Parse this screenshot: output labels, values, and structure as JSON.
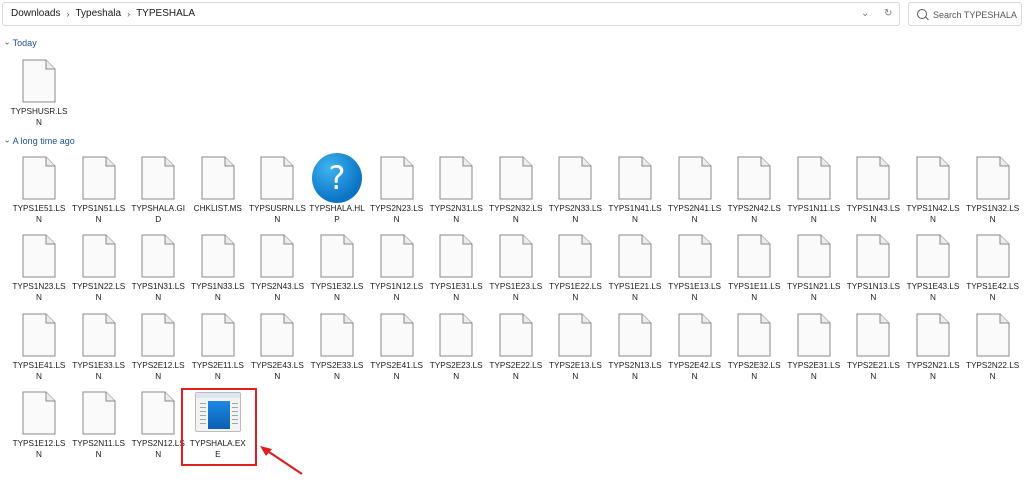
{
  "address_bar": {
    "crumbs": [
      "Downloads",
      "Typeshala",
      "TYPESHALA"
    ]
  },
  "search": {
    "placeholder": "Search TYPESHALA"
  },
  "groups": {
    "today": "Today",
    "long_ago": "A long time ago"
  },
  "files": {
    "today": [
      "TYPSHUSR.LSN"
    ],
    "row1": [
      "TYPS1E51.LSN",
      "TYPS1N51.LSN",
      "TYPSHALA.GID",
      "CHKLIST.MS",
      "TYPSUSRN.LSN",
      "TYPSHALA.HLP",
      "TYPS2N23.LSN",
      "TYPS2N31.LSN",
      "TYPS2N32.LSN",
      "TYPS2N33.LSN",
      "TYPS1N41.LSN",
      "TYPS2N41.LSN",
      "TYPS2N42.LSN",
      "TYPS1N11.LSN",
      "TYPS1N43.LSN",
      "TYPS1N42.LSN",
      "TYPS1N32.LSN"
    ],
    "row2": [
      "TYPS1N23.LSN",
      "TYPS1N22.LSN",
      "TYPS1N31.LSN",
      "TYPS1N33.LSN",
      "TYPS2N43.LSN",
      "TYPS1E32.LSN",
      "TYPS1N12.LSN",
      "TYPS1E31.LSN",
      "TYPS1E23.LSN",
      "TYPS1E22.LSN",
      "TYPS1E21.LSN",
      "TYPS1E13.LSN",
      "TYPS1E11.LSN",
      "TYPS1N21.LSN",
      "TYPS1N13.LSN",
      "TYPS1E43.LSN",
      "TYPS1E42.LSN"
    ],
    "row3": [
      "TYPS1E41.LSN",
      "TYPS1E33.LSN",
      "TYPS2E12.LSN",
      "TYPS2E11.LSN",
      "TYPS2E43.LSN",
      "TYPS2E33.LSN",
      "TYPS2E41.LSN",
      "TYPS2E23.LSN",
      "TYPS2E22.LSN",
      "TYPS2E13.LSN",
      "TYPS2N13.LSN",
      "TYPS2E42.LSN",
      "TYPS2E32.LSN",
      "TYPS2E31.LSN",
      "TYPS2E21.LSN",
      "TYPS2N21.LSN",
      "TYPS2N22.LSN"
    ],
    "row4": [
      "TYPS1E12.LSN",
      "TYPS2N11.LSN",
      "TYPS2N12.LSN",
      "TYPSHALA.EXE"
    ]
  },
  "colors": {
    "group_label": "#1d4f91",
    "highlight": "#e02020"
  }
}
